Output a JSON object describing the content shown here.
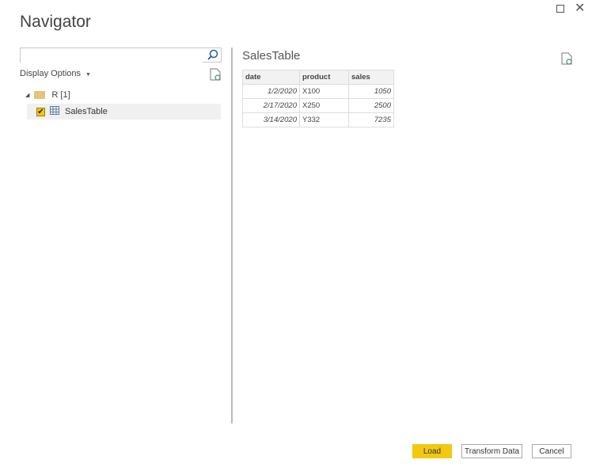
{
  "window": {
    "title": "Navigator"
  },
  "search": {
    "value": "",
    "placeholder": ""
  },
  "display_options": "Display Options",
  "tree": {
    "folder": "R [1]",
    "items": [
      {
        "label": "SalesTable",
        "checked": true
      }
    ]
  },
  "preview": {
    "title": "SalesTable",
    "columns": [
      "date",
      "product",
      "sales"
    ],
    "rows": [
      [
        "1/2/2020",
        "X100",
        "1050"
      ],
      [
        "2/17/2020",
        "X250",
        "2500"
      ],
      [
        "3/14/2020",
        "Y332",
        "7235"
      ]
    ]
  },
  "buttons": {
    "load": "Load",
    "transform": "Transform Data",
    "cancel": "Cancel"
  },
  "colors": {
    "accent": "#f2c811"
  }
}
